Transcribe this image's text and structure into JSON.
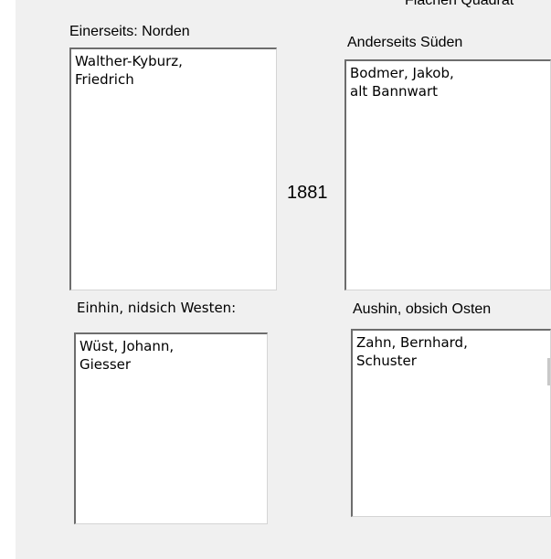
{
  "header": {
    "cutoff_text": "Flächen Quadrat"
  },
  "year": "1881",
  "neighbors": {
    "north": {
      "label": "Einerseits: Norden",
      "lines": [
        "Walther-Kyburz,",
        "Friedrich"
      ]
    },
    "south": {
      "label": "Anderseits Süden",
      "lines": [
        "Bodmer, Jakob,",
        "alt Bannwart"
      ]
    },
    "west": {
      "label": "Einhin, nidsich Westen:",
      "lines": [
        "Wüst, Johann,",
        "Giesser"
      ]
    },
    "east": {
      "label": "Aushin,  obsich Osten",
      "lines": [
        "Zahn, Bernhard,",
        "Schuster"
      ]
    }
  }
}
